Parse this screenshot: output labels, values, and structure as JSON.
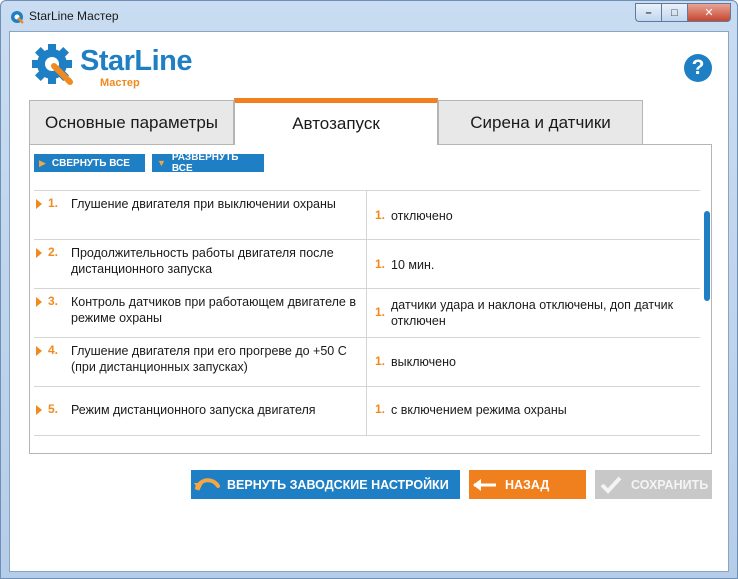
{
  "window": {
    "title": "StarLine Мастер"
  },
  "header": {
    "logo_text": "StarLine",
    "logo_sub": "Мастер",
    "help_label": "?"
  },
  "tabs": [
    {
      "label": "Основные параметры"
    },
    {
      "label": "Автозапуск"
    },
    {
      "label": "Сирена и датчики"
    }
  ],
  "toolbar": {
    "collapse_label": "СВЕРНУТЬ ВСЕ",
    "expand_label": "РАЗВЕРНУТЬ ВСЕ"
  },
  "settings": [
    {
      "num": "1.",
      "label": "Глушение двигателя при выключении охраны",
      "option_num": "1.",
      "value": "отключено"
    },
    {
      "num": "2.",
      "label": "Продолжительность работы двигателя после дистанционного запуска",
      "option_num": "1.",
      "value": "10 мин."
    },
    {
      "num": "3.",
      "label": "Контроль датчиков при работающем двигателе в режиме охраны",
      "option_num": "1.",
      "value": "датчики удара и наклона отключены, доп датчик отключен"
    },
    {
      "num": "4.",
      "label": "Глушение двигателя при его прогреве до +50 С (при дистанционных запусках)",
      "option_num": "1.",
      "value": "выключено"
    },
    {
      "num": "5.",
      "label": "Режим дистанционного запуска двигателя",
      "option_num": "1.",
      "value": "с включением режима охраны"
    }
  ],
  "buttons": {
    "reset_label": "ВЕРНУТЬ ЗАВОДСКИЕ НАСТРОЙКИ",
    "back_label": "НАЗАД",
    "save_label": "СОХРАНИТЬ"
  },
  "colors": {
    "brand_blue": "#1f7fc4",
    "accent_orange": "#f07f1d",
    "disabled_gray": "#c8c8c8"
  }
}
